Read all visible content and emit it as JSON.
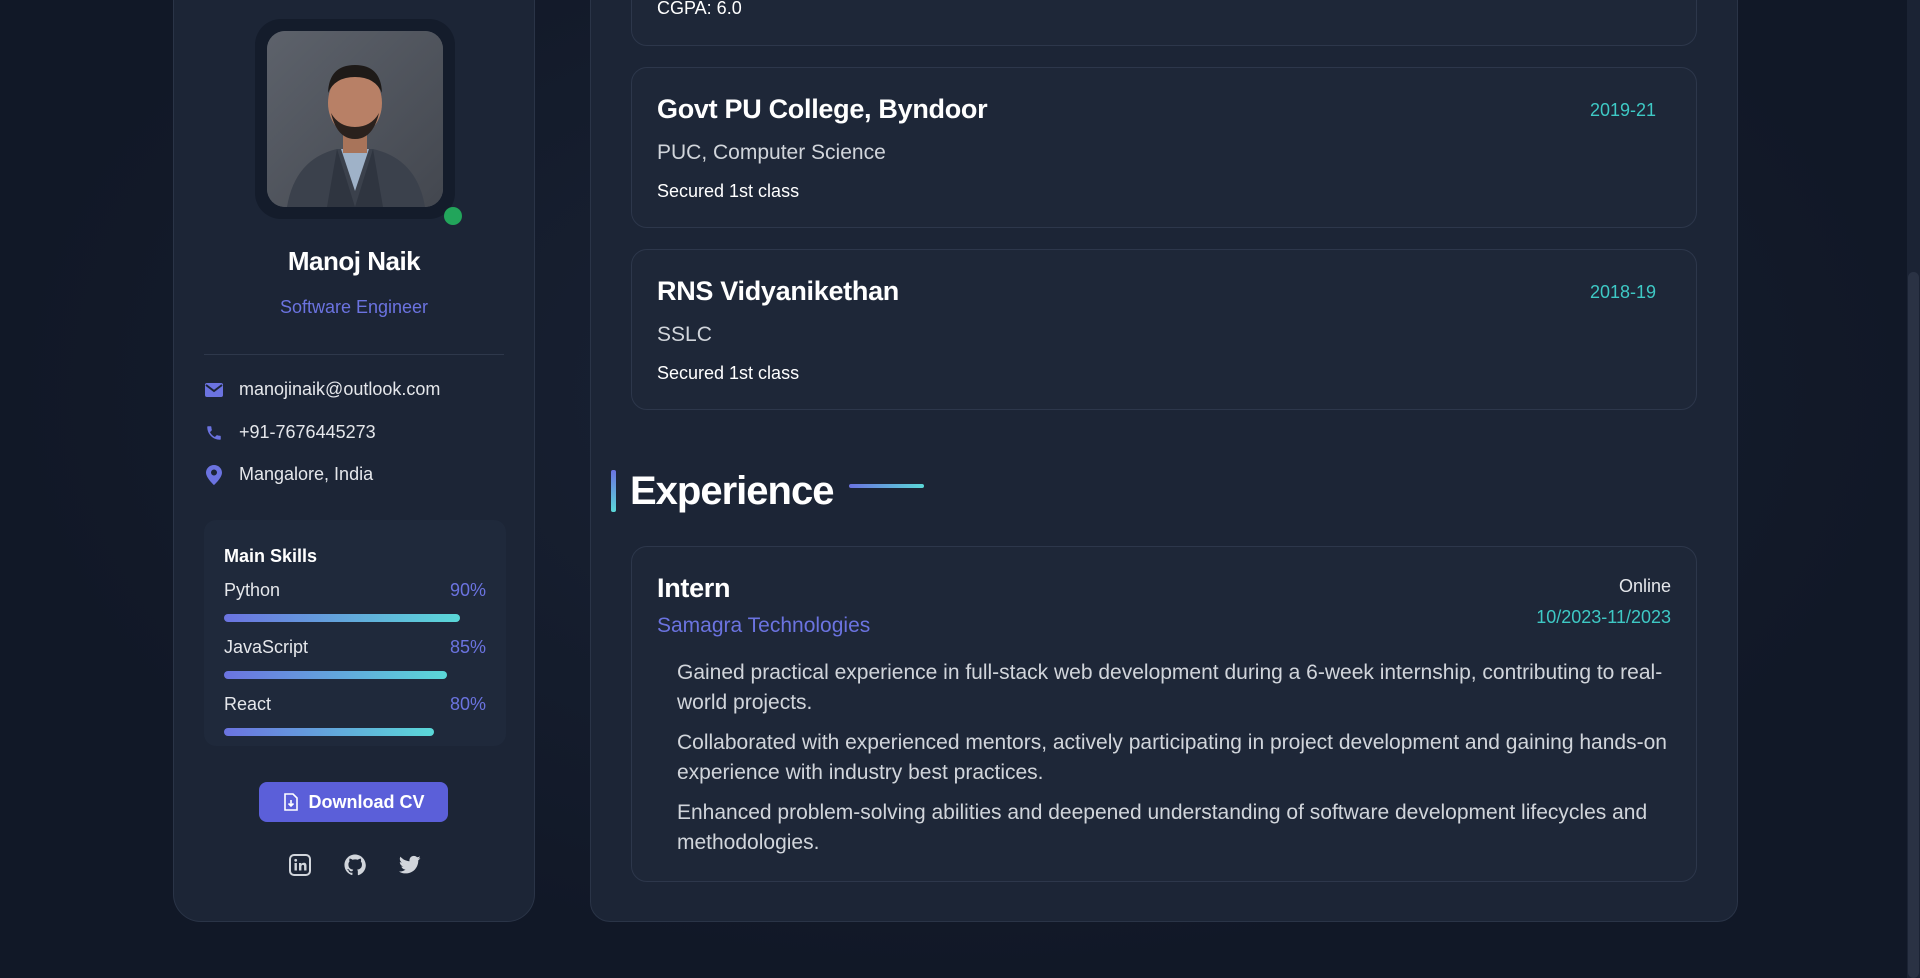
{
  "profile": {
    "name": "Manoj Naik",
    "role": "Software Engineer",
    "status": "online",
    "contacts": {
      "email": "manojinaik@outlook.com",
      "phone": "+91-7676445273",
      "location": "Mangalore, India"
    },
    "skills_title": "Main Skills",
    "skills": [
      {
        "name": "Python",
        "pct": "90%",
        "level": 0.9
      },
      {
        "name": "JavaScript",
        "pct": "85%",
        "level": 0.85
      },
      {
        "name": "React",
        "pct": "80%",
        "level": 0.8
      }
    ],
    "download_label": "Download CV",
    "social_icons": [
      "linkedin-icon",
      "github-icon",
      "twitter-icon"
    ]
  },
  "education": {
    "partial_note": "CGPA: 6.0",
    "items": [
      {
        "school": "Govt PU College, Byndoor",
        "degree": "PUC, Computer Science",
        "note": "Secured 1st class",
        "years": "2019-21"
      },
      {
        "school": "RNS Vidyanikethan",
        "degree": "SSLC",
        "note": "Secured 1st class",
        "years": "2018-19"
      }
    ]
  },
  "experience": {
    "heading": "Experience",
    "items": [
      {
        "title": "Intern",
        "company": "Samagra Technologies",
        "mode": "Online",
        "dates": "10/2023-11/2023",
        "points": [
          "Gained practical experience in full-stack web development during a 6-week internship, contributing to real-world projects.",
          "Collaborated with experienced mentors, actively participating in project development and gaining hands-on experience with industry best practices.",
          "Enhanced problem-solving abilities and deepened understanding of software development lifecycles and methodologies."
        ]
      }
    ]
  },
  "colors": {
    "accent": "#6b73e0",
    "teal": "#3ec9c5",
    "online": "#22a55b",
    "bg": "#111827",
    "card": "#1c2536"
  }
}
